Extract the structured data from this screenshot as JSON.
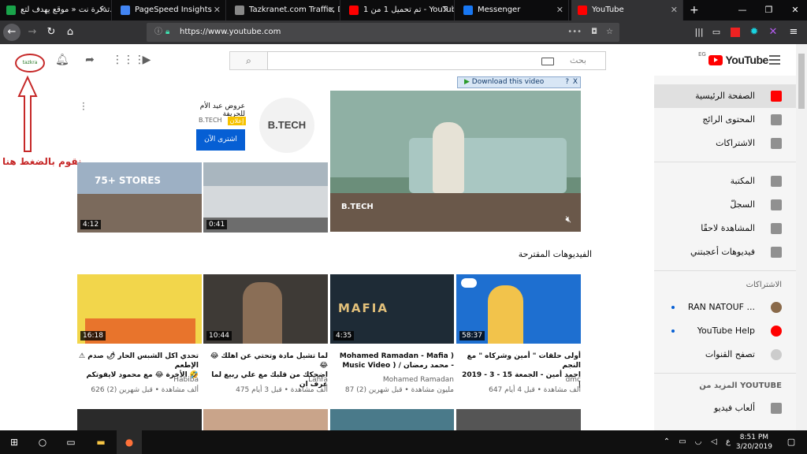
{
  "browser": {
    "tabs": [
      {
        "title": "تذكرة نت « موقع يهدف لتع...",
        "color": "#19a34a"
      },
      {
        "title": "PageSpeed Insights",
        "color": "#4285f4"
      },
      {
        "title": "Tazkranet.com Traffic, De...",
        "color": "#888888"
      },
      {
        "title": "تم تحميل 1 من 1 - YouTube",
        "color": "#ff0000"
      },
      {
        "title": "Messenger",
        "color": "#1877f2"
      },
      {
        "title": "YouTube",
        "color": "#ff0000"
      }
    ],
    "url": "https://www.youtube.com",
    "win_minimize": "—",
    "win_maximize": "❐",
    "win_close": "✕",
    "new_tab": "+"
  },
  "youtube": {
    "search_placeholder": "بحث",
    "logo_text": "YouTube",
    "country": "EG",
    "download_bar": "Download this video",
    "download_help": "?",
    "download_close": "X"
  },
  "sidebar": {
    "main": [
      {
        "label": "الصفحة الرئيسية",
        "icon": "home-icon"
      },
      {
        "label": "المحتوى الرائج",
        "icon": "trending-icon"
      },
      {
        "label": "الاشتراكات",
        "icon": "subscriptions-icon"
      }
    ],
    "library": [
      {
        "label": "المكتبة",
        "icon": "library-icon"
      },
      {
        "label": "السجلّ",
        "icon": "history-icon"
      },
      {
        "label": "المشاهدة لاحقًا",
        "icon": "watch-later-icon"
      },
      {
        "label": "فيديوهات أعجبتني",
        "icon": "like-icon"
      }
    ],
    "subs_heading": "الاشتراكات",
    "subs": [
      {
        "label": "RAN NATOUF ...",
        "avatar_color": "#8a6a4a"
      },
      {
        "label": "YouTube Help",
        "avatar_color": "#ff0000"
      },
      {
        "label": "تصفح القنوات",
        "avatar_color": "#cccccc"
      }
    ],
    "more_heading": "المزيد من YOUTUBE",
    "more": [
      {
        "label": "ألعاب فيديو",
        "icon": "gaming-icon"
      }
    ]
  },
  "ad": {
    "brand": "B.TECH",
    "title": "عروض عيد الأم للحريفة",
    "badge": "إعلان",
    "advertiser": "B.TECH",
    "cta": "اشترى الآن",
    "main_watermark": "B.TECH",
    "thumbs": [
      {
        "duration": "4:12",
        "overlay": "75+ STORES"
      },
      {
        "duration": "0:41"
      }
    ]
  },
  "section_title": "الفيديوهات المقترحة",
  "videos": [
    {
      "title_line1": "⚠ تحدي اكل الشبس الحار 🌶 صدم الإطعم",
      "title_line2": "الأخرة 😂 مع محمود لايفوتكم 🤣",
      "channel": "Habiba",
      "meta": "626 ألف مشاهدة • قبل شهرين (2)",
      "duration": "16:18"
    },
    {
      "title_line1": "😂 لما تشيل مادة وتحتي عن اهلك 😂",
      "title_line2": "اضحكك من قلبك مع علي ربيع لما عرف ان",
      "channel": "Lahfa",
      "meta": "475 ألف مشاهدة • قبل 3 أيام",
      "duration": "10:44"
    },
    {
      "title_line1": "Mohamed Ramadan - Mafia )",
      "title_line2": "Music Video ) / محمد رمضان -",
      "channel": "Mohamed Ramadan",
      "meta": "87 مليون مشاهدة • قبل شهرين (2)",
      "duration": "4:35"
    },
    {
      "title_line1": "أولى حلقات \" أمين وشركاه \" مع النجم",
      "title_line2": "احمد أمين - الجمعة 15 - 3 - 2019 |",
      "channel": "dmc",
      "meta": "647 ألف مشاهدة • قبل 4 أيام",
      "duration": "58:37"
    }
  ],
  "annotation": {
    "text": "نقوم بالضغط هنا"
  },
  "taskbar": {
    "time": "8:51 PM",
    "date": "3/20/2019",
    "lang": "ع"
  }
}
